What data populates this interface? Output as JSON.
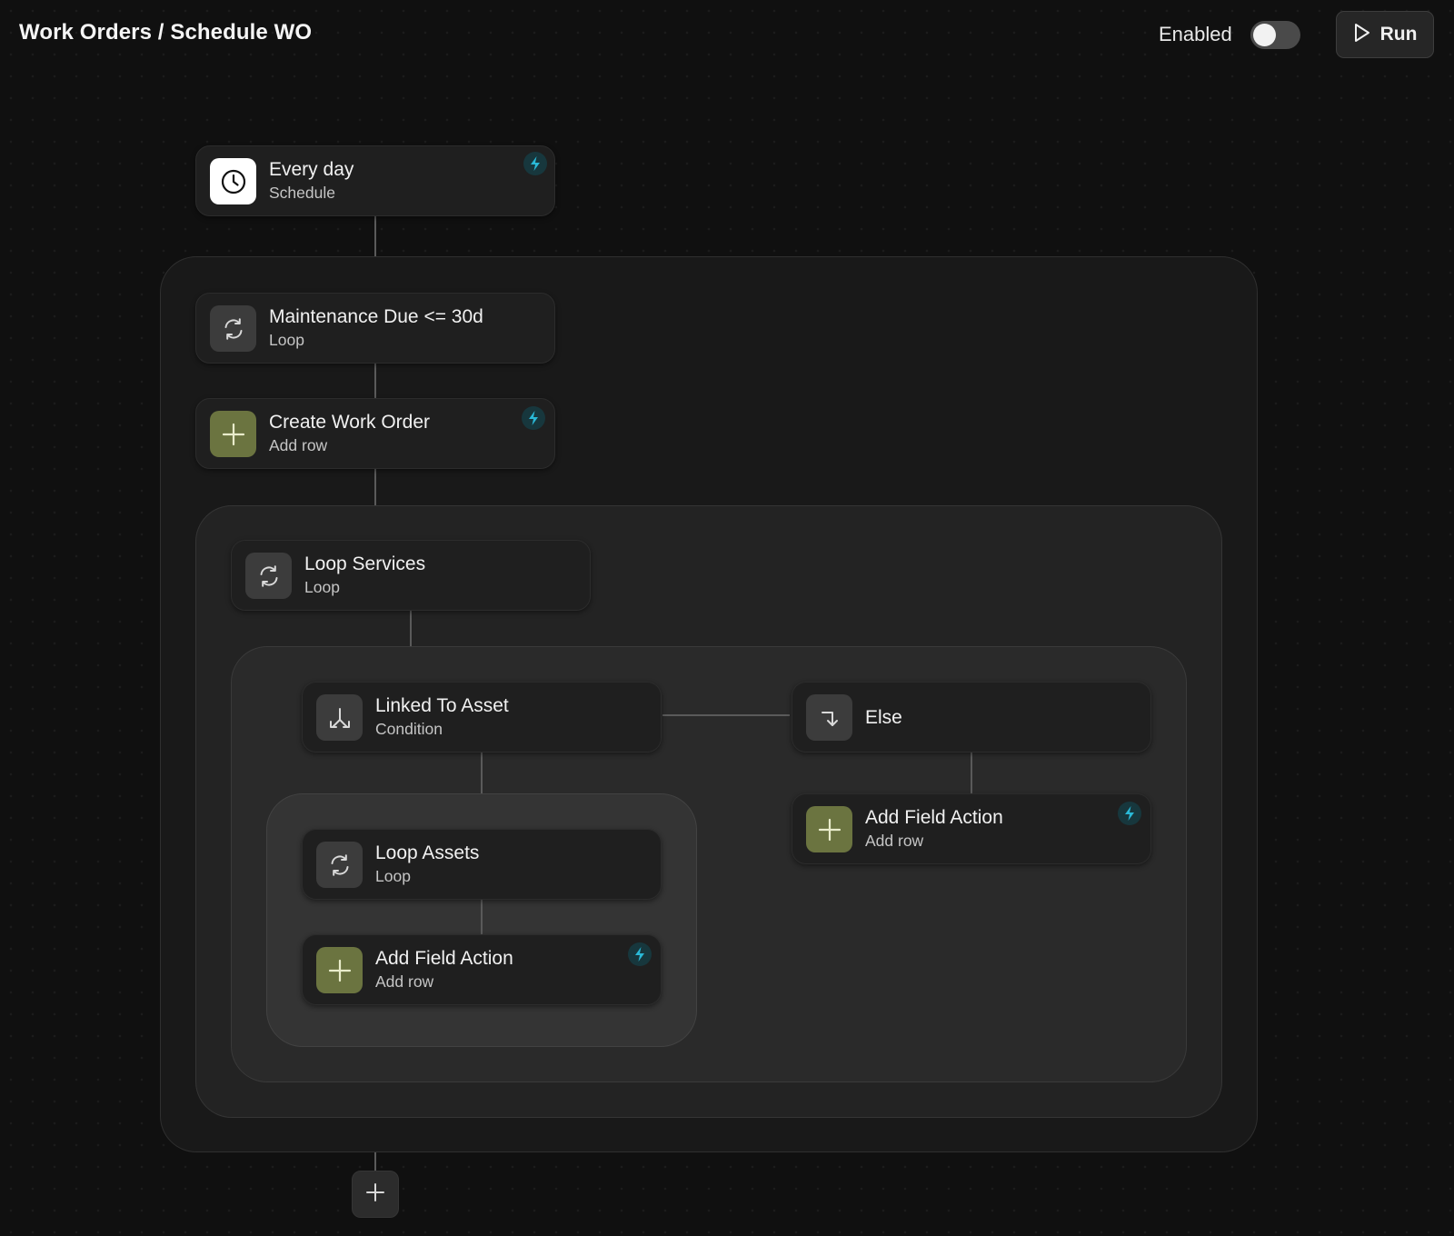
{
  "header": {
    "breadcrumb": "Work Orders / Schedule WO",
    "enabled_label": "Enabled",
    "enabled": false,
    "run_label": "Run"
  },
  "nodes": {
    "trigger": {
      "title": "Every day",
      "subtitle": "Schedule",
      "icon": "clock-icon"
    },
    "loop_maintenance": {
      "title": "Maintenance Due <= 30d",
      "subtitle": "Loop",
      "icon": "loop-icon"
    },
    "create_work_order": {
      "title": "Create Work Order",
      "subtitle": "Add row",
      "icon": "plus-icon"
    },
    "loop_services": {
      "title": "Loop Services",
      "subtitle": "Loop",
      "icon": "loop-icon"
    },
    "condition": {
      "title": "Linked To Asset",
      "subtitle": "Condition",
      "icon": "branch-icon"
    },
    "else": {
      "title": "Else",
      "icon": "else-arrow-icon"
    },
    "loop_assets": {
      "title": "Loop Assets",
      "subtitle": "Loop",
      "icon": "loop-icon"
    },
    "add_field_action_if": {
      "title": "Add Field Action",
      "subtitle": "Add row",
      "icon": "plus-icon"
    },
    "add_field_action_else": {
      "title": "Add Field Action",
      "subtitle": "Add row",
      "icon": "plus-icon"
    }
  },
  "colors": {
    "background": "#101010",
    "accent_green": "#6b7440",
    "bolt_cyan": "#2ab8d6",
    "bolt_bg": "#17373d"
  }
}
